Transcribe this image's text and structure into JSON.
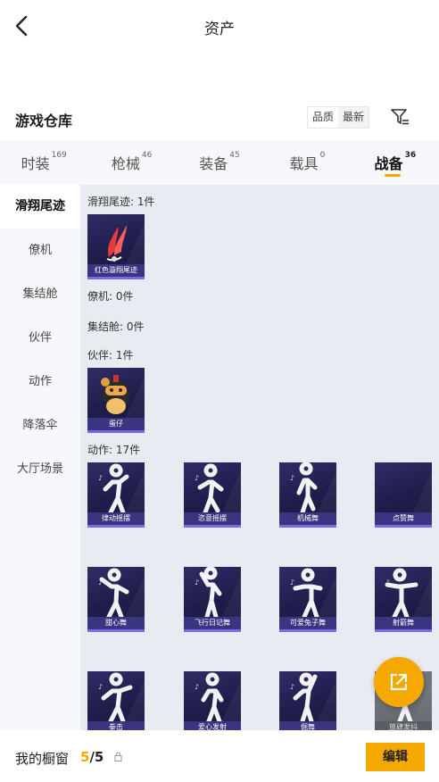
{
  "header": {
    "title": "资产"
  },
  "warehouse": {
    "title": "游戏仓库"
  },
  "sort": {
    "quality": "品质",
    "newest": "最新"
  },
  "tabs": [
    {
      "label": "时装",
      "count": "169"
    },
    {
      "label": "枪械",
      "count": "46"
    },
    {
      "label": "装备",
      "count": "45"
    },
    {
      "label": "载具",
      "count": "0"
    },
    {
      "label": "战备",
      "count": "36"
    }
  ],
  "sidebar": [
    {
      "label": "滑翔尾迹"
    },
    {
      "label": "僚机"
    },
    {
      "label": "集结舱"
    },
    {
      "label": "伙伴"
    },
    {
      "label": "动作"
    },
    {
      "label": "降落伞"
    },
    {
      "label": "大厅场景"
    }
  ],
  "sections": {
    "glide": {
      "label": "滑翔尾迹: 1件",
      "items": [
        "红色漩翔尾迹"
      ]
    },
    "wingman": {
      "label": "僚机: 0件"
    },
    "pod": {
      "label": "集结舱: 0件"
    },
    "partner": {
      "label": "伙伴: 1件",
      "items": [
        "蛋仔"
      ]
    },
    "emote": {
      "label": "动作: 17件",
      "items": [
        "律动摇摆",
        "恣意摇摆",
        "机械舞",
        "点赞舞",
        "甜心舞",
        "飞行日记舞",
        "可爱兔子舞",
        "射箭舞",
        "拳击",
        "爱心发射",
        "倔舞",
        "放肆发抖"
      ]
    }
  },
  "bottom": {
    "label": "我的橱窗",
    "current": "5",
    "total": "/5",
    "edit": "编辑"
  },
  "colors": {
    "accent": "#f5a800",
    "card": "#252357",
    "panel": "#e8ecf2"
  },
  "icons": [
    "back-arrow-icon",
    "filter-icon",
    "share-external-icon",
    "lock-icon"
  ]
}
